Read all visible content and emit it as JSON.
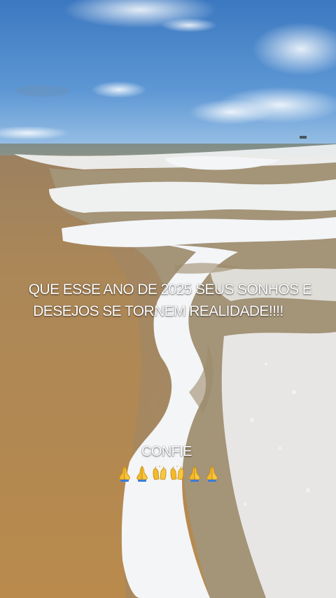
{
  "overlay": {
    "caption_line1": "QUE ESSE ANO DE 2025 SEUS SONHOS E",
    "caption_line2": "DESEJOS SE TORNEM REALIDADE!!!!",
    "confie_text": "CONFIE"
  },
  "emojis": [
    {
      "icon": "praying-hands-icon"
    },
    {
      "icon": "praying-hands-icon"
    },
    {
      "icon": "raised-hands-icon"
    },
    {
      "icon": "raised-hands-icon"
    },
    {
      "icon": "praying-hands-icon"
    },
    {
      "icon": "praying-hands-icon"
    }
  ],
  "colors": {
    "sky": "#4a84c6",
    "sand": "#b8894f",
    "foam": "#f4f6f8",
    "text": "#ffffff",
    "emoji": "#f2b92b"
  }
}
